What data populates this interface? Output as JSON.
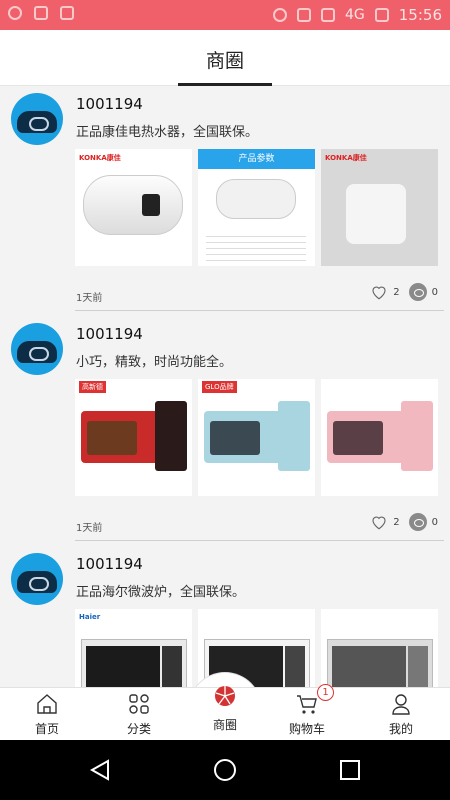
{
  "status_bar": {
    "time": "15:56",
    "network": "4G"
  },
  "header": {
    "title": "商圈"
  },
  "posts": [
    {
      "username": "1001194",
      "text": "正品康佳电热水器，全国联保。",
      "time": "1天前",
      "likes": "2",
      "views": "0",
      "images": [
        {
          "brand": "KONKA康佳"
        },
        {
          "header": "产品参数"
        },
        {
          "brand": "KONKA康佳"
        }
      ]
    },
    {
      "username": "1001194",
      "text": "小巧，精致，时尚功能全。",
      "time": "1天前",
      "likes": "2",
      "views": "0",
      "images": [
        {
          "tag": "高新德"
        },
        {
          "tag": "GLO品牌"
        },
        {
          "tag": ""
        }
      ]
    },
    {
      "username": "1001194",
      "text": "正品海尔微波炉，全国联保。",
      "images": [
        {
          "brand": "Haier"
        },
        {
          "brand": ""
        },
        {
          "brand": ""
        }
      ]
    }
  ],
  "tabbar": {
    "items": [
      {
        "label": "首页"
      },
      {
        "label": "分类"
      },
      {
        "label": "商圈"
      },
      {
        "label": "购物车",
        "badge": "1"
      },
      {
        "label": "我的"
      }
    ]
  },
  "colors": {
    "status": "#f0606a",
    "accent": "#d33333"
  }
}
